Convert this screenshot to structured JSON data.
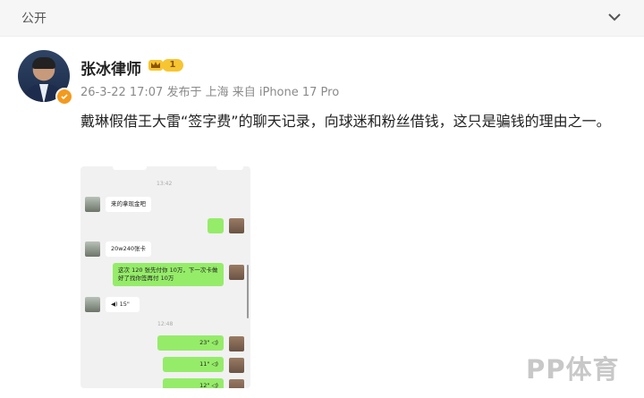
{
  "header": {
    "visibility_label": "公开",
    "collapse_icon": "chevron-down-icon"
  },
  "author": {
    "name": "张冰律师",
    "level": "1",
    "badge_icon": "crown-icon",
    "verified_icon": "verified-check-icon"
  },
  "post": {
    "meta": "26-3-22 17:07 发布于 上海 来自 iPhone 17 Pro",
    "text": "戴琳假借王大雷“签字费”的聊天记录，向球迷和粉丝借钱，这只是骗钱的理由之一。"
  },
  "chat": {
    "time1": "13:42",
    "msg1": "来的拿现金吧",
    "msg3": "20w240张卡",
    "msg4": "这次 120 张先付你 10万，下一次卡做好了找你签再付 10万",
    "voice1": "◀) 15\"",
    "time2": "12:48",
    "voice2": "23\" ◁)",
    "voice3": "11\" ◁)",
    "voice4": "12\" ◁)"
  },
  "watermark": "PP体育"
}
